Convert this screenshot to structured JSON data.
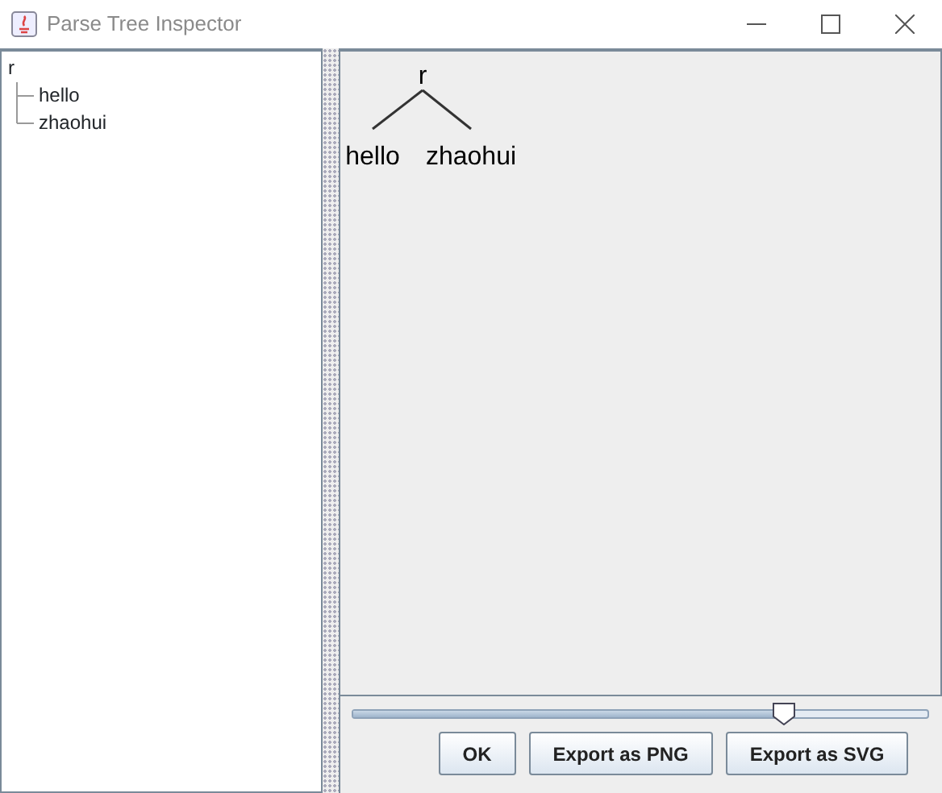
{
  "window": {
    "title": "Parse Tree Inspector"
  },
  "tree": {
    "label": "r",
    "expanded": true,
    "children": [
      {
        "label": "hello"
      },
      {
        "label": "zhaohui"
      }
    ]
  },
  "diagram": {
    "root": "r",
    "children": [
      "hello",
      "zhaohui"
    ]
  },
  "zoom_slider": {
    "level": 0.75
  },
  "buttons": [
    "OK",
    "Export as PNG",
    "Export as SVG"
  ]
}
